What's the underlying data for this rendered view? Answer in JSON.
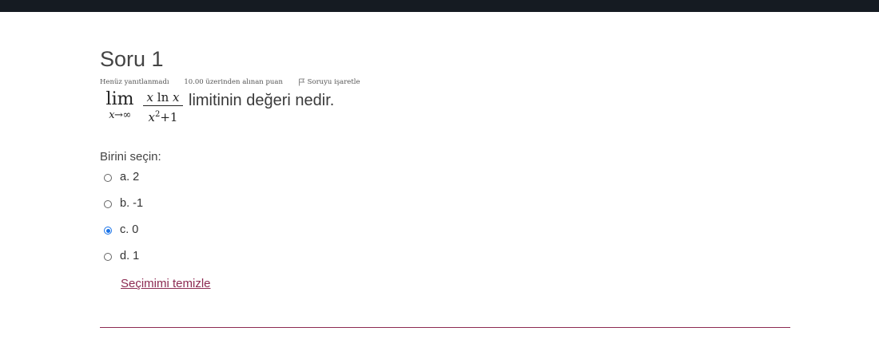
{
  "question": {
    "title": "Soru 1",
    "status": "Henüz yanıtlanmadı",
    "points": "10.00 üzerinden alınan puan",
    "flag_label": "Soruyu işaretle",
    "math": {
      "lim_word": "lim",
      "lim_sub": "x→∞",
      "numerator_x1": "x",
      "numerator_ln": "ln",
      "numerator_x2": "x",
      "denominator_base": "x",
      "denominator_exp": "2",
      "denominator_rest": "+1"
    },
    "text_rest": "limitinin değeri nedir."
  },
  "prompt": "Birini seçin:",
  "answers": [
    {
      "label": "a. 2",
      "selected": false
    },
    {
      "label": "b. -1",
      "selected": false
    },
    {
      "label": "c. 0",
      "selected": true
    },
    {
      "label": "d. 1",
      "selected": false
    }
  ],
  "clear_choice": "Seçimimi temizle",
  "colors": {
    "accent_link": "#8c2a52",
    "radio_selected": "#1a73e8",
    "topbar": "#151b22"
  }
}
